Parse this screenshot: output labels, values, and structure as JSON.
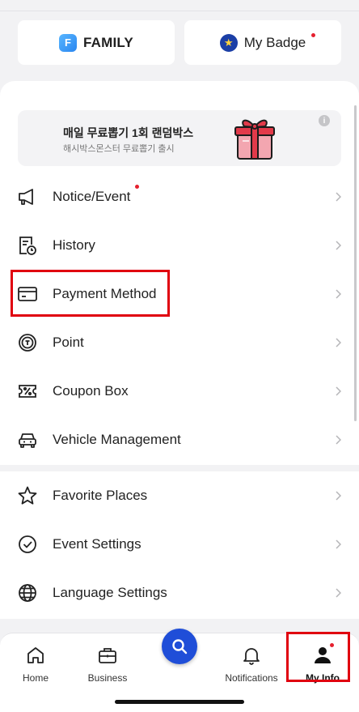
{
  "top_cards": {
    "family_label": "FAMILY",
    "family_icon_letter": "F",
    "badge_label": "My Badge",
    "badge_icon_glyph": "★"
  },
  "promo": {
    "title": "매일 무료뽑기 1회 랜덤박스",
    "subtitle": "해시박스몬스터 무료뽑기 출시",
    "info_glyph": "i"
  },
  "menu": {
    "group1": [
      {
        "label": "Notice/Event",
        "icon": "megaphone-icon",
        "has_dot": true
      },
      {
        "label": "History",
        "icon": "history-icon",
        "has_dot": false
      },
      {
        "label": "Payment Method",
        "icon": "card-icon",
        "has_dot": false
      },
      {
        "label": "Point",
        "icon": "point-icon",
        "has_dot": false
      },
      {
        "label": "Coupon Box",
        "icon": "coupon-icon",
        "has_dot": false
      },
      {
        "label": "Vehicle Management",
        "icon": "car-icon",
        "has_dot": false
      }
    ],
    "group2": [
      {
        "label": "Favorite Places",
        "icon": "star-icon"
      },
      {
        "label": "Event Settings",
        "icon": "check-circle-icon"
      },
      {
        "label": "Language Settings",
        "icon": "globe-icon"
      }
    ]
  },
  "tabbar": {
    "tabs": [
      {
        "label": "Home",
        "icon": "home-icon"
      },
      {
        "label": "Business",
        "icon": "briefcase-icon"
      },
      {
        "label": "Notifications",
        "icon": "bell-icon"
      },
      {
        "label": "My Info",
        "icon": "person-icon",
        "active": true,
        "has_dot": true
      }
    ],
    "center_button_icon": "search-icon"
  },
  "colors": {
    "highlight": "#e0000f",
    "accent_blue": "#1f4ed8",
    "notification_dot": "#e5202e"
  }
}
